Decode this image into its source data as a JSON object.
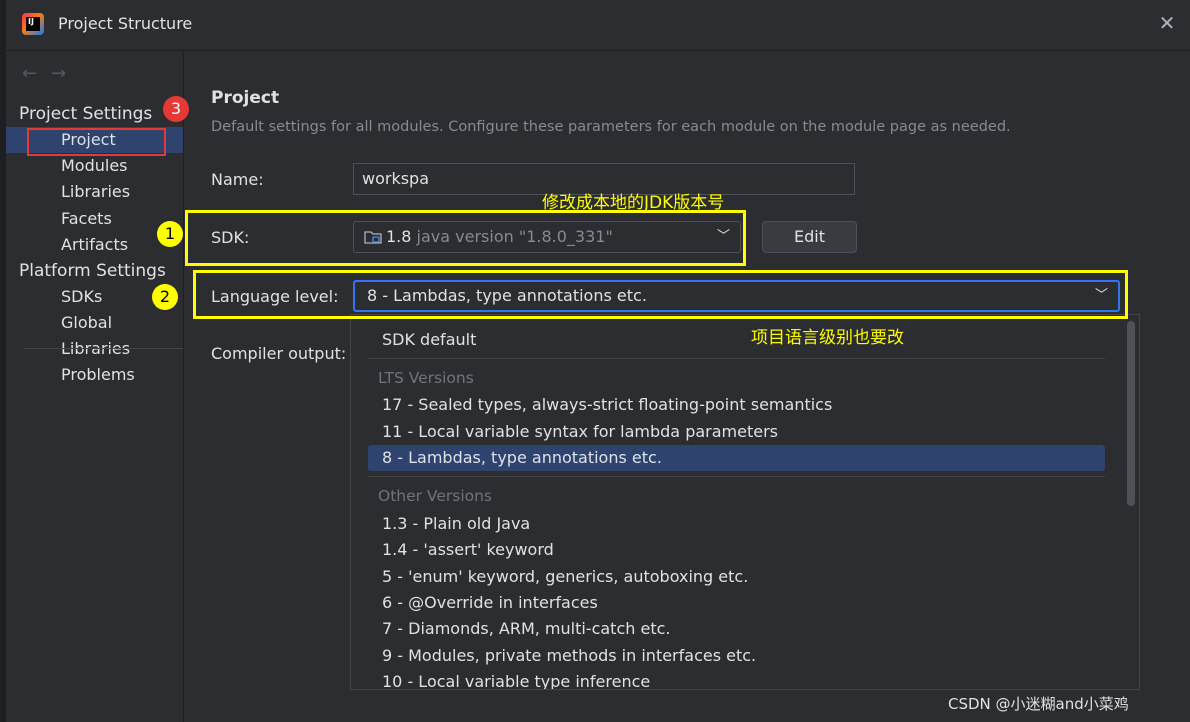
{
  "window": {
    "title": "Project Structure",
    "close_icon": "close-icon"
  },
  "sidebar": {
    "nav_back_icon": "arrow-left-icon",
    "nav_forward_icon": "arrow-right-icon",
    "project_settings_header": "Project Settings",
    "project_settings_items": [
      {
        "label": "Project",
        "selected": true
      },
      {
        "label": "Modules"
      },
      {
        "label": "Libraries"
      },
      {
        "label": "Facets"
      },
      {
        "label": "Artifacts"
      }
    ],
    "platform_settings_header": "Platform Settings",
    "platform_settings_items": [
      {
        "label": "SDKs"
      },
      {
        "label": "Global Libraries"
      }
    ],
    "problems_item": "Problems"
  },
  "main": {
    "title": "Project",
    "description": "Default settings for all modules. Configure these parameters for each module on the module page as needed.",
    "name_label": "Name:",
    "name_value": "workspa",
    "sdk_label": "SDK:",
    "sdk_icon": "folder-coffee-icon",
    "sdk_version": "1.8",
    "sdk_detail": "java version \"1.8.0_331\"",
    "edit_button": "Edit",
    "language_level_label": "Language level:",
    "language_level_value": "8 - Lambdas, type annotations etc.",
    "compiler_output_label": "Compiler output:"
  },
  "dropdown": {
    "sdk_default": "SDK default",
    "lts_header": "LTS Versions",
    "lts_items": [
      "17 - Sealed types, always-strict floating-point semantics",
      "11 - Local variable syntax for lambda parameters",
      "8 - Lambdas, type annotations etc."
    ],
    "selected": "8 - Lambdas, type annotations etc.",
    "other_header": "Other Versions",
    "other_items": [
      "1.3 - Plain old Java",
      "1.4 - 'assert' keyword",
      "5 - 'enum' keyword, generics, autoboxing etc.",
      "6 - @Override in interfaces",
      "7 - Diamonds, ARM, multi-catch etc.",
      "9 - Modules, private methods in interfaces etc.",
      "10 - Local variable type inference"
    ]
  },
  "annotations": {
    "badge_1": "1",
    "badge_2": "2",
    "badge_3": "3",
    "sdk_note": "修改成本地的JDK版本号",
    "lang_note": "项目语言级别也要改",
    "highlight_color": "#ffff00",
    "marker_red": "#e53935"
  },
  "watermark": "CSDN @小迷糊and小菜鸡",
  "colors": {
    "accent": "#3574f0",
    "selection": "#2e436e",
    "background": "#2b2d30"
  }
}
